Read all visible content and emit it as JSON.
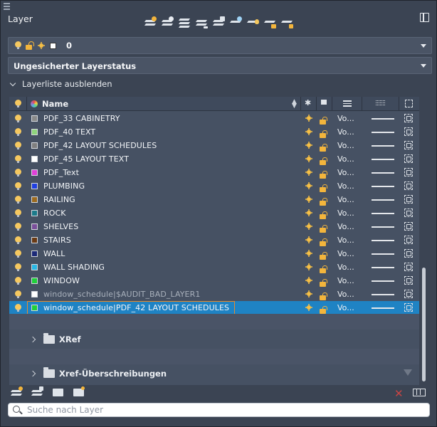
{
  "window": {
    "title": "Layer"
  },
  "toolbar": {
    "icons": [
      "new-layer-icon",
      "new-layer-vp-frozen-icon",
      "delete-layer-icon",
      "set-current-icon",
      "layer-states-icon",
      "freeze-all-icon",
      "isolate-icon",
      "lock-icon",
      "unlock-icon"
    ]
  },
  "current_layer": {
    "value": "0"
  },
  "layer_state": {
    "value": "Ungesicherter Layerstatus"
  },
  "section_toggle": {
    "label": "Layerliste ausblenden"
  },
  "grid": {
    "columns": {
      "name": "Name"
    },
    "rows": [
      {
        "name": "PDF_33 CABINETRY",
        "color": "#8a8a8a",
        "linetype": "Vo...",
        "dim": false
      },
      {
        "name": "PDF_40 TEXT",
        "color": "#8fd47c",
        "linetype": "Vo...",
        "dim": false
      },
      {
        "name": "PDF_42 LAYOUT SCHEDULES",
        "color": "#7f7f7f",
        "linetype": "Vo...",
        "dim": false
      },
      {
        "name": "PDF_45 LAYOUT TEXT",
        "color": "#ffffff",
        "linetype": "Vo...",
        "dim": false
      },
      {
        "name": "PDF_Text",
        "color": "#e040d8",
        "linetype": "Vo...",
        "dim": false
      },
      {
        "name": "PLUMBING",
        "color": "#1f3fe0",
        "linetype": "Vo...",
        "dim": false
      },
      {
        "name": "RAILING",
        "color": "#9c6a1f",
        "linetype": "Vo...",
        "dim": false
      },
      {
        "name": "ROCK",
        "color": "#1c7a8a",
        "linetype": "Vo...",
        "dim": false
      },
      {
        "name": "SHELVES",
        "color": "#7a4f9a",
        "linetype": "Vo...",
        "dim": false
      },
      {
        "name": "STAIRS",
        "color": "#6a3a14",
        "linetype": "Vo...",
        "dim": false
      },
      {
        "name": "WALL",
        "color": "#1c2a78",
        "linetype": "Vo...",
        "dim": false
      },
      {
        "name": "WALL SHADING",
        "color": "#2ab8e6",
        "linetype": "Vo...",
        "dim": false
      },
      {
        "name": "WINDOW",
        "color": "#1fcf3a",
        "linetype": "Vo...",
        "dim": false
      },
      {
        "name": "window_schedule|$AUDIT_BAD_LAYER1",
        "color": "#ffffff",
        "linetype": "Vo...",
        "dim": true
      },
      {
        "name": "window_schedule|PDF_42 LAYOUT SCHEDULES",
        "color": "#1fcf3a",
        "linetype": "Vo...",
        "dim": false,
        "selected": true
      }
    ]
  },
  "groups": {
    "xref": "XRef",
    "xref_overrides": "Xref-Überschreibungen"
  },
  "search": {
    "placeholder": "Suche nach Layer"
  },
  "colors": {
    "accent_selected": "#1f83c4",
    "highlight_border": "#e98b2d",
    "bulb": "#f5c860",
    "lock": "#f3b53c"
  }
}
